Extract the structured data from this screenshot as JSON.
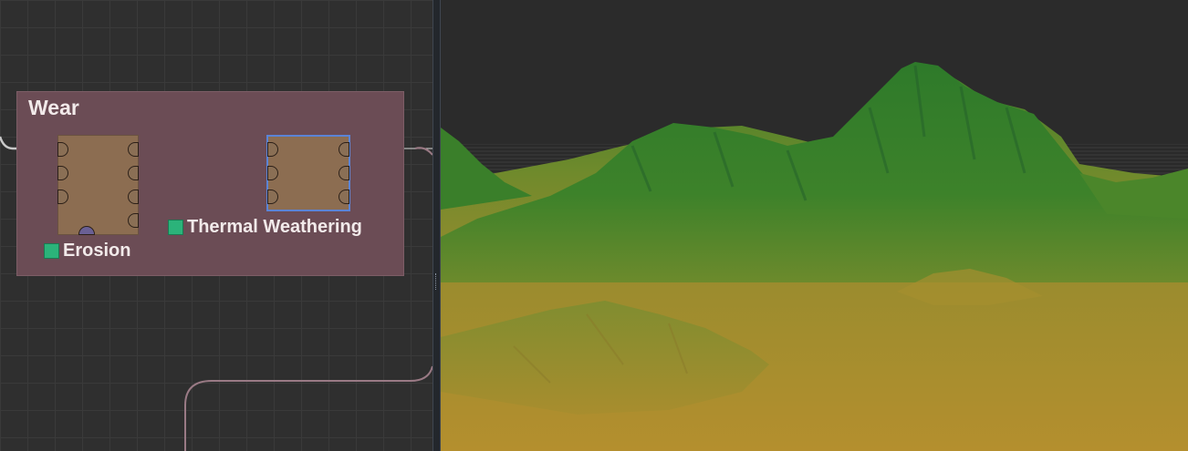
{
  "graph": {
    "group": {
      "title": "Wear"
    },
    "nodes": [
      {
        "id": "erosion",
        "label": "Erosion",
        "enabled": true,
        "selected": false
      },
      {
        "id": "thermal",
        "label": "Thermal Weathering",
        "enabled": true,
        "selected": true
      }
    ]
  },
  "viewport": {
    "view": "3D terrain preview"
  },
  "colors": {
    "group": "#6b4c55",
    "node": "#8c6d51",
    "enable": "#2bb37a",
    "selection": "#5b84d6",
    "terrain_high": "#2f7a2a",
    "terrain_low": "#b48f2e"
  }
}
